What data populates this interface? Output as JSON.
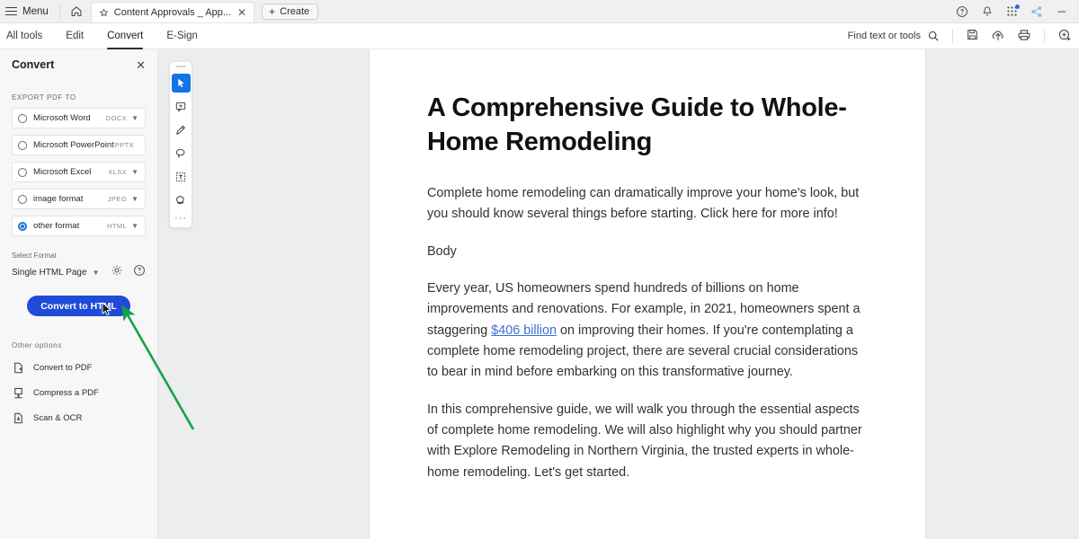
{
  "titlebar": {
    "menu_label": "Menu",
    "home_icon": "home-icon",
    "tab": {
      "star_icon": "star-icon",
      "label": "Content Approvals _ App...",
      "close_icon": "close-icon"
    },
    "create_label": "Create",
    "icons": [
      "help-circle-icon",
      "bell-icon",
      "apps-grid-icon",
      "share-icon",
      "minimize-icon"
    ]
  },
  "toolsbar": {
    "tabs": [
      {
        "label": "All tools",
        "active": false
      },
      {
        "label": "Edit",
        "active": false
      },
      {
        "label": "Convert",
        "active": true
      },
      {
        "label": "E-Sign",
        "active": false
      }
    ],
    "find_label": "Find text or tools",
    "icons": [
      "search-icon",
      "save-icon",
      "upload-cloud-icon",
      "print-icon",
      "add-stamp-icon"
    ]
  },
  "panel": {
    "title": "Convert",
    "close_icon": "close-icon",
    "export_label": "Export PDF to",
    "formats": [
      {
        "name": "Microsoft Word",
        "ext": "DOCX",
        "selected": false,
        "has_chevron": true
      },
      {
        "name": "Microsoft PowerPoint",
        "ext": "PPTX",
        "selected": false,
        "has_chevron": false
      },
      {
        "name": "Microsoft Excel",
        "ext": "XLSX",
        "selected": false,
        "has_chevron": true
      },
      {
        "name": "image format",
        "ext": "JPEG",
        "selected": false,
        "has_chevron": true
      },
      {
        "name": "other format",
        "ext": "HTML",
        "selected": true,
        "has_chevron": true
      }
    ],
    "select_format_label": "Select Format",
    "select_format_value": "Single HTML Page",
    "gear_icon": "gear-icon",
    "help_icon": "help-circle-icon",
    "convert_button": "Convert to HTML",
    "convert_button_color": "#1f4bd8",
    "other_options_label": "Other options",
    "other_options": [
      {
        "label": "Convert to PDF",
        "icon": "convert-to-pdf-icon"
      },
      {
        "label": "Compress a PDF",
        "icon": "compress-pdf-icon"
      },
      {
        "label": "Scan & OCR",
        "icon": "scan-ocr-icon"
      }
    ]
  },
  "vertical_toolbar": {
    "tools": [
      {
        "icon": "select-cursor-icon",
        "active": true
      },
      {
        "icon": "add-comment-icon",
        "active": false
      },
      {
        "icon": "highlight-pen-icon",
        "active": false
      },
      {
        "icon": "lasso-select-icon",
        "active": false
      },
      {
        "icon": "text-box-icon",
        "active": false
      },
      {
        "icon": "stamp-icon",
        "active": false
      }
    ],
    "more_icon": "more-horizontal-icon"
  },
  "document": {
    "title": "A Comprehensive Guide to Whole-Home Remodeling",
    "paragraphs": [
      {
        "text": "Complete home remodeling can dramatically improve your home's look, but you should know several things before starting. Click here for more info!"
      },
      {
        "text": "Body"
      },
      {
        "pre": "Every year, US homeowners spend hundreds of billions on home improvements and renovations. For example, in 2021, homeowners spent a staggering ",
        "link": "$406 billion",
        "post": " on improving their homes. If you're contemplating a complete home remodeling project, there are several crucial considerations to bear in mind before embarking on this transformative journey."
      },
      {
        "text": "In this comprehensive guide, we will walk you through the essential aspects of complete home remodeling. We will also highlight why you should partner with Explore Remodeling in Northern Virginia, the trusted experts in whole-home remodeling. Let's get started."
      }
    ]
  },
  "annotation": {
    "arrow_color": "#15a24a",
    "arrow_target": "convert-to-html-button",
    "cursor_icon": "mouse-pointer-icon"
  }
}
